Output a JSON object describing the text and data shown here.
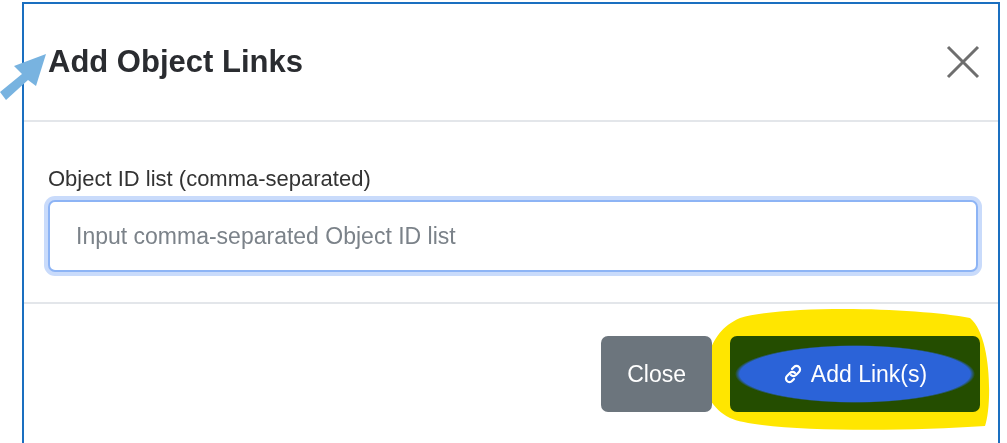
{
  "dialog": {
    "title": "Add Object Links",
    "field": {
      "label": "Object ID list (comma-separated)",
      "placeholder": "Input comma-separated Object ID list"
    },
    "buttons": [
      {
        "label": "Close",
        "kind": "secondary",
        "highlighted": false
      },
      {
        "label": "Add Link(s)",
        "kind": "primary",
        "highlighted": true
      }
    ]
  }
}
